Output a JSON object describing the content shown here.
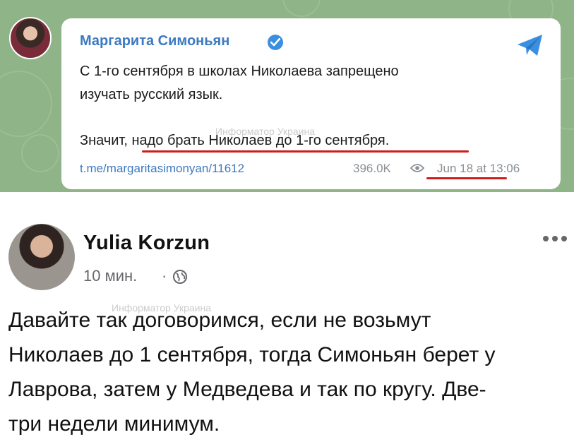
{
  "telegram": {
    "author": "Маргарита Симоньян",
    "verified_icon": "verified-badge-icon",
    "send_icon": "telegram-plane-icon",
    "text_line1": "С 1-го сентября в школах Николаева запрещено",
    "text_line2": "изучать русский язык.",
    "text_line3": "Значит, надо брать Николаев до 1-го сентября.",
    "link": "t.me/margaritasimonyan/11612",
    "views": "396.0K",
    "date": "Jun 18 at 13:06",
    "accent_color": "#d01c1c"
  },
  "watermark": "Информатор Украина",
  "facebook": {
    "name": "Yulia Korzun",
    "time": "10 мин.",
    "dot": "·",
    "text_line1": "Давайте так договоримся, если не возьмут",
    "text_line2": "Николаев до 1 сентября, тогда Симоньян берет у",
    "text_line3": "Лаврова, затем у Медведева и так по кругу. Две-",
    "text_line4": "три недели минимум."
  }
}
